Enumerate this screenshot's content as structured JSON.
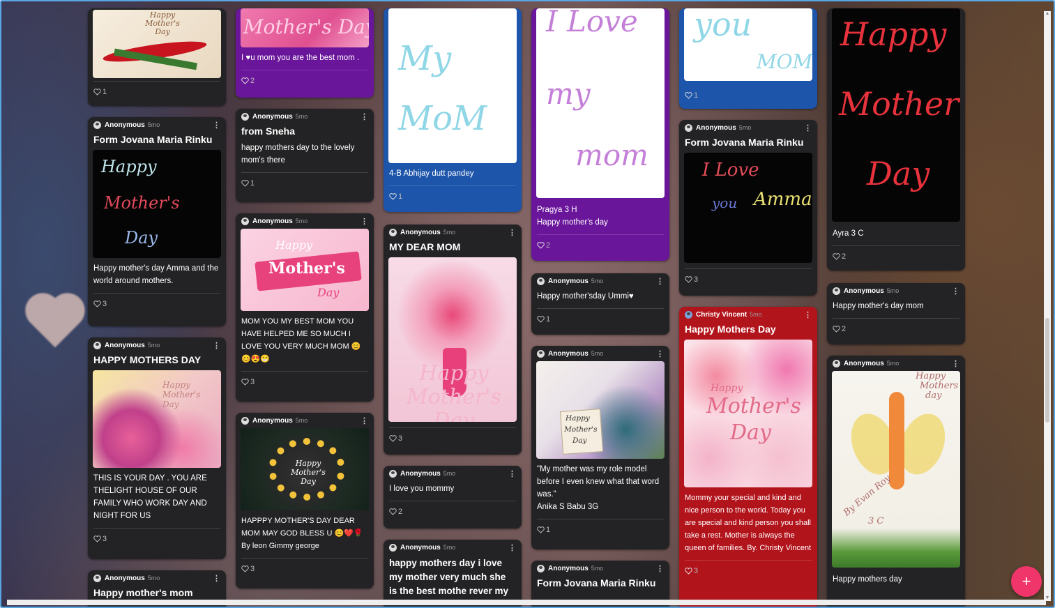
{
  "board": {
    "fab_label": "+",
    "colors": {
      "purple": "#6a169b",
      "blue": "#1d55aa",
      "red": "#b2141c",
      "dark": "#232325",
      "fab": "#f0356a"
    }
  },
  "cards": {
    "c1a": {
      "likes": "1",
      "image_text": "Happy Mother's Day"
    },
    "c1b": {
      "author": "Anonymous",
      "time": "5mo",
      "title": "Form Jovana Maria Rinku",
      "image_text": [
        "Happy",
        "Mother's",
        "Day"
      ],
      "body": "Happy mother's day Amma and the world around mothers.",
      "likes": "3"
    },
    "c1c": {
      "author": "Anonymous",
      "time": "5mo",
      "title": "HAPPY MOTHERS DAY",
      "image_text": "Happy Mother's Day",
      "body": "THIS IS YOUR DAY . YOU ARE THELIGHT HOUSE OF OUR FAMILY WHO WORK DAY AND NIGHT FOR US",
      "likes": "3"
    },
    "c1d": {
      "author": "Anonymous",
      "time": "5mo",
      "title": "Happy mother's mom"
    },
    "c2a": {
      "image_text": "Mother's Day",
      "body": "I ♥u mom you are the best mom .",
      "likes": "2"
    },
    "c2b": {
      "author": "Anonymous",
      "time": "5mo",
      "title": "from Sneha",
      "body": "happy mothers day to the lovely mom's there",
      "likes": "1"
    },
    "c2c": {
      "author": "Anonymous",
      "time": "5mo",
      "image_text": [
        "Happy",
        "Mother's",
        "Day"
      ],
      "body": "MOM YOU MY BEST MOM YOU HAVE HELPED ME SO MUCH I LOVE YOU VERY MUCH MOM 😊 😊😍😁",
      "likes": "3"
    },
    "c2d": {
      "author": "Anonymous",
      "time": "5mo",
      "image_text": "Happy Mother's Day",
      "body": "HAPPPY MOTHER'S DAY DEAR MOM MAY GOD BLESS U 😊❤️🌹 By leon Gimmy george",
      "likes": "3"
    },
    "c3a": {
      "image_text": [
        "My",
        "MoM"
      ],
      "body": "4-B Abhijay dutt pandey",
      "likes": "1"
    },
    "c3b": {
      "author": "Anonymous",
      "time": "5mo",
      "title": "MY DEAR MOM",
      "image_text": "Happy Mother's Day",
      "likes": "3"
    },
    "c3c": {
      "author": "Anonymous",
      "time": "5mo",
      "body": "I love you mommy",
      "likes": "2"
    },
    "c3d": {
      "author": "Anonymous",
      "time": "5mo",
      "title": "happy mothers day i love my mother very much she is the best mothe rever my"
    },
    "c4a": {
      "image_text": [
        "I Love",
        "my",
        "mom"
      ],
      "body": "Pragya 3 H\nHappy mother's day",
      "likes": "2"
    },
    "c4b": {
      "author": "Anonymous",
      "time": "5mo",
      "body": "Happy mother'sday Ummi♥",
      "likes": "1"
    },
    "c4c": {
      "author": "Anonymous",
      "time": "5mo",
      "image_text": [
        "Happy",
        "Mother's",
        "Day"
      ],
      "body": "\"My mother was my role model before I even knew what that word was.\"\nAnika S Babu 3G",
      "likes": "1"
    },
    "c4d": {
      "author": "Anonymous",
      "time": "5mo",
      "title": "Form Jovana Maria Rinku"
    },
    "c5a": {
      "image_text": [
        "you",
        "MOM"
      ],
      "likes": "1"
    },
    "c5b": {
      "author": "Anonymous",
      "time": "5mo",
      "title": "Form Jovana Maria Rinku",
      "image_text": [
        "I Love",
        "you",
        "Amma"
      ],
      "likes": "3"
    },
    "c5c": {
      "author": "Christy Vincent",
      "time": "5mo",
      "title": "Happy Mothers Day",
      "image_text": [
        "Happy",
        "Mother's",
        "Day"
      ],
      "body": "Mommy  your special and kind and nice person to the world. Today you are special and kind person you shall take a rest. Mother is always the queen of families. By. Christy Vincent",
      "likes": "3"
    },
    "c6a": {
      "image_text": [
        "Happy",
        "Mother's",
        "Day"
      ],
      "body": "Ayra 3 C",
      "likes": "2"
    },
    "c6b": {
      "author": "Anonymous",
      "time": "5mo",
      "body": "Happy mother's day mom",
      "likes": "2"
    },
    "c6c": {
      "author": "Anonymous",
      "time": "5mo",
      "image_text": [
        "Happy",
        "Mothers",
        "day",
        "By Evan Roy",
        "3 C"
      ],
      "body": "Happy mothers day"
    }
  }
}
